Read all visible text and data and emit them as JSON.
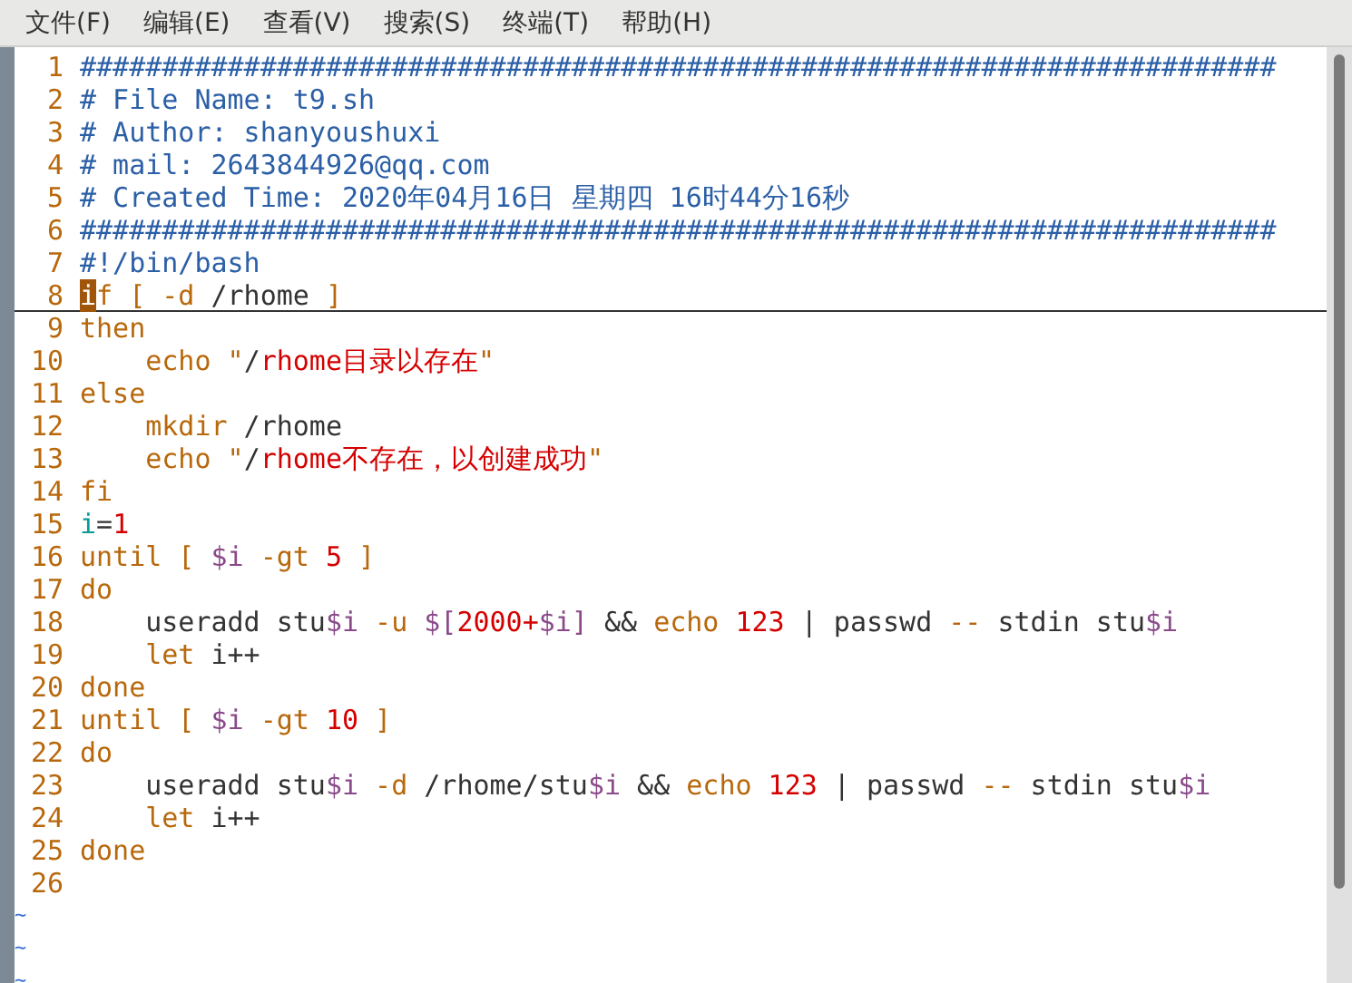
{
  "menu": [
    "文件(F)",
    "编辑(E)",
    "查看(V)",
    "搜索(S)",
    "终端(T)",
    "帮助(H)"
  ],
  "lines": [
    {
      "number": "1",
      "tokens": [
        {
          "text": "#########################################################################",
          "kind": "comment"
        }
      ]
    },
    {
      "number": "2",
      "tokens": [
        {
          "text": "# File Name: t9.sh",
          "kind": "comment"
        }
      ]
    },
    {
      "number": "3",
      "tokens": [
        {
          "text": "# Author: shanyoushuxi",
          "kind": "comment"
        }
      ]
    },
    {
      "number": "4",
      "tokens": [
        {
          "text": "# mail: 2643844926@qq.com",
          "kind": "comment"
        }
      ]
    },
    {
      "number": "5",
      "tokens": [
        {
          "text": "# Created Time: 2020年04月16日 星期四 16时44分16秒",
          "kind": "comment"
        }
      ]
    },
    {
      "number": "6",
      "tokens": [
        {
          "text": "#########################################################################",
          "kind": "comment"
        }
      ]
    },
    {
      "number": "7",
      "tokens": [
        {
          "text": "#!/bin/bash",
          "kind": "comment"
        }
      ]
    },
    {
      "number": "8",
      "cursorline": true,
      "tokens": [
        {
          "text": "i",
          "kind": "cursor"
        },
        {
          "text": "f [ -d",
          "kind": "keyword"
        },
        {
          "text": " /rhome",
          "kind": "plain"
        },
        {
          "text": " ]",
          "kind": "keyword"
        }
      ]
    },
    {
      "number": "9",
      "tokens": [
        {
          "text": "then",
          "kind": "keyword"
        }
      ]
    },
    {
      "number": "10",
      "tokens": [
        {
          "text": "    echo \"",
          "kind": "keyword"
        },
        {
          "text": "/",
          "kind": "plain"
        },
        {
          "text": "rhome目录以存在",
          "kind": "string"
        },
        {
          "text": "\"",
          "kind": "keyword"
        }
      ]
    },
    {
      "number": "11",
      "tokens": [
        {
          "text": "else",
          "kind": "keyword"
        }
      ]
    },
    {
      "number": "12",
      "tokens": [
        {
          "text": "    mkdir",
          "kind": "keyword"
        },
        {
          "text": " /rhome",
          "kind": "plain"
        }
      ]
    },
    {
      "number": "13",
      "tokens": [
        {
          "text": "    echo \"",
          "kind": "keyword"
        },
        {
          "text": "/",
          "kind": "plain"
        },
        {
          "text": "rhome不存在，以创建成功",
          "kind": "string"
        },
        {
          "text": "\"",
          "kind": "keyword"
        }
      ]
    },
    {
      "number": "14",
      "tokens": [
        {
          "text": "fi",
          "kind": "keyword"
        }
      ]
    },
    {
      "number": "15",
      "tokens": [
        {
          "text": "i",
          "kind": "identifier"
        },
        {
          "text": "=",
          "kind": "plain"
        },
        {
          "text": "1",
          "kind": "string"
        }
      ]
    },
    {
      "number": "16",
      "tokens": [
        {
          "text": "until [ ",
          "kind": "keyword"
        },
        {
          "text": "$i",
          "kind": "variable"
        },
        {
          "text": " -gt",
          "kind": "keyword"
        },
        {
          "text": " 5",
          "kind": "string"
        },
        {
          "text": " ]",
          "kind": "keyword"
        }
      ]
    },
    {
      "number": "17",
      "tokens": [
        {
          "text": "do",
          "kind": "keyword"
        }
      ]
    },
    {
      "number": "18",
      "tokens": [
        {
          "text": "    useradd stu",
          "kind": "plain"
        },
        {
          "text": "$i",
          "kind": "variable"
        },
        {
          "text": " -u",
          "kind": "keyword"
        },
        {
          "text": " $[",
          "kind": "variable"
        },
        {
          "text": "2000+",
          "kind": "string"
        },
        {
          "text": "$i]",
          "kind": "variable"
        },
        {
          "text": " && ",
          "kind": "plain"
        },
        {
          "text": "echo",
          "kind": "keyword"
        },
        {
          "text": " 123",
          "kind": "string"
        },
        {
          "text": " | passwd",
          "kind": "plain"
        },
        {
          "text": " --",
          "kind": "keyword"
        },
        {
          "text": " stdin stu",
          "kind": "plain"
        },
        {
          "text": "$i",
          "kind": "variable"
        }
      ]
    },
    {
      "number": "19",
      "tokens": [
        {
          "text": "    let",
          "kind": "keyword"
        },
        {
          "text": " i++",
          "kind": "plain"
        }
      ]
    },
    {
      "number": "20",
      "tokens": [
        {
          "text": "done",
          "kind": "keyword"
        }
      ]
    },
    {
      "number": "21",
      "tokens": [
        {
          "text": "until [ ",
          "kind": "keyword"
        },
        {
          "text": "$i",
          "kind": "variable"
        },
        {
          "text": " -gt",
          "kind": "keyword"
        },
        {
          "text": " 10",
          "kind": "string"
        },
        {
          "text": " ]",
          "kind": "keyword"
        }
      ]
    },
    {
      "number": "22",
      "tokens": [
        {
          "text": "do",
          "kind": "keyword"
        }
      ]
    },
    {
      "number": "23",
      "tokens": [
        {
          "text": "    useradd stu",
          "kind": "plain"
        },
        {
          "text": "$i",
          "kind": "variable"
        },
        {
          "text": " -d",
          "kind": "keyword"
        },
        {
          "text": " /rhome/stu",
          "kind": "plain"
        },
        {
          "text": "$i",
          "kind": "variable"
        },
        {
          "text": " && ",
          "kind": "plain"
        },
        {
          "text": "echo",
          "kind": "keyword"
        },
        {
          "text": " 123",
          "kind": "string"
        },
        {
          "text": " | passwd",
          "kind": "plain"
        },
        {
          "text": " --",
          "kind": "keyword"
        },
        {
          "text": " stdin stu",
          "kind": "plain"
        },
        {
          "text": "$i",
          "kind": "variable"
        }
      ]
    },
    {
      "number": "24",
      "tokens": [
        {
          "text": "    let",
          "kind": "keyword"
        },
        {
          "text": " i++",
          "kind": "plain"
        }
      ]
    },
    {
      "number": "25",
      "tokens": [
        {
          "text": "done",
          "kind": "keyword"
        }
      ]
    },
    {
      "number": "26"
    }
  ],
  "empty_line_markers": [
    "~",
    "~",
    "~"
  ]
}
